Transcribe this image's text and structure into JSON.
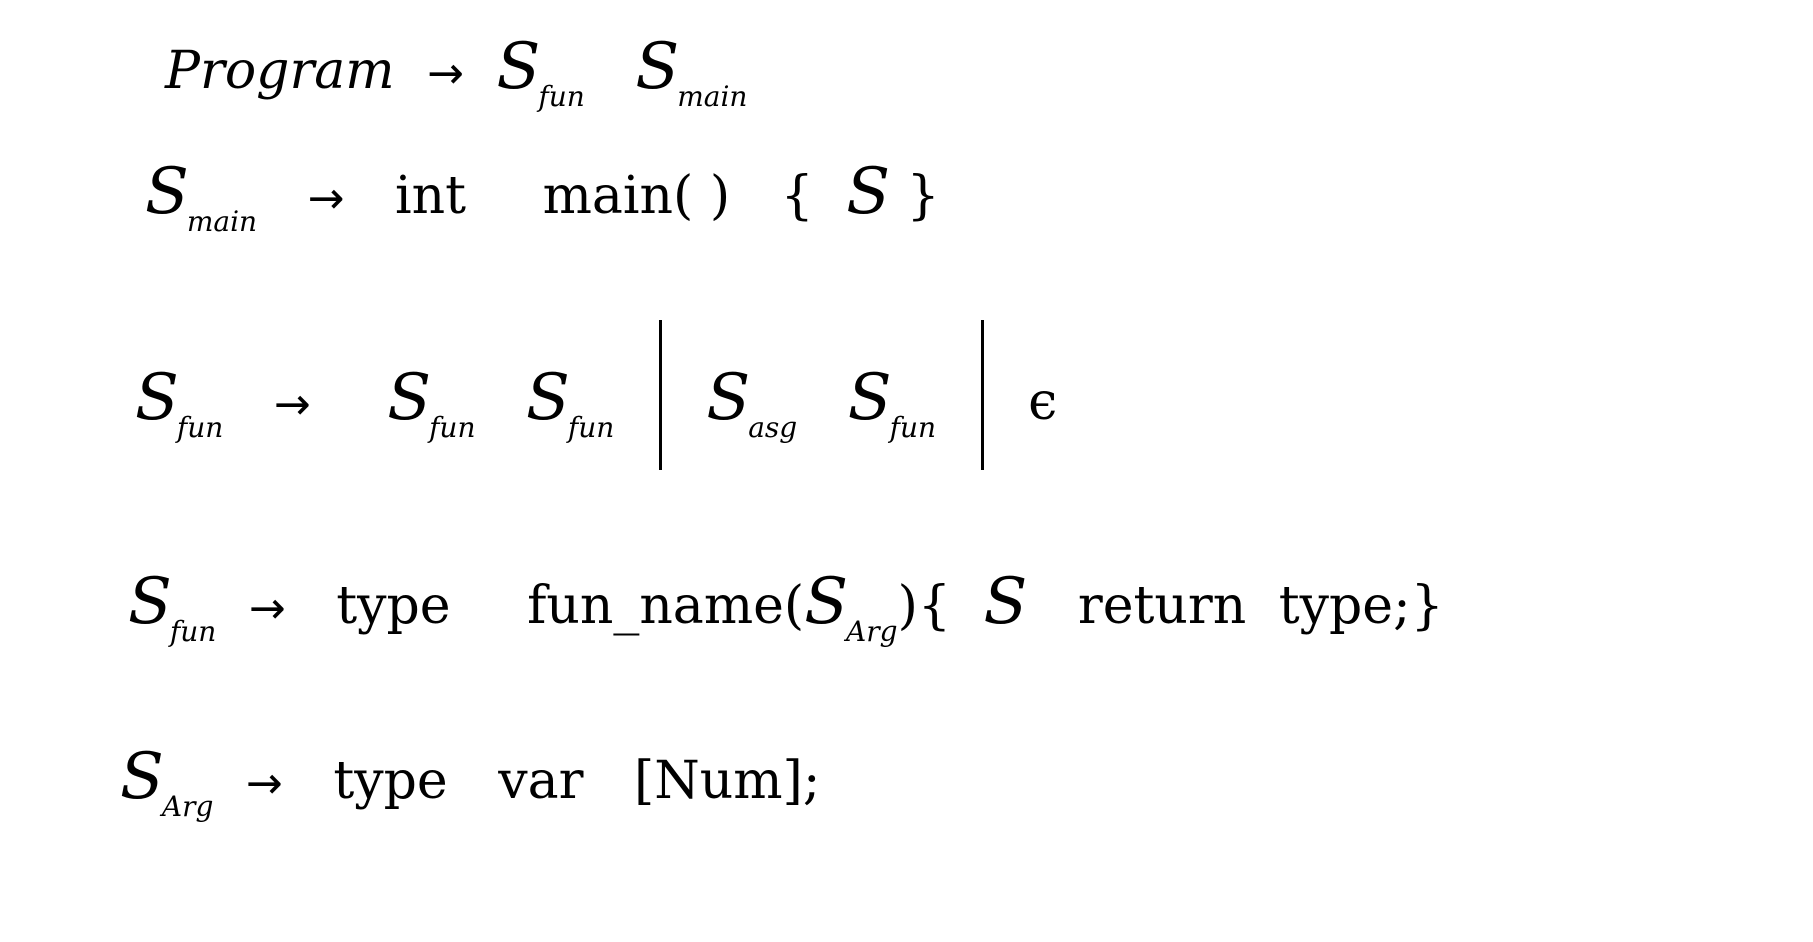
{
  "grammar": {
    "rule1": {
      "lhs": "Program",
      "arrow": "→",
      "rhs": [
        {
          "sym": "S",
          "sub": "fun"
        },
        {
          "sym": "S",
          "sub": "main"
        }
      ]
    },
    "rule2": {
      "lhs": {
        "sym": "S",
        "sub": "main"
      },
      "arrow": "→",
      "rhs": {
        "t1": "int",
        "t2": "main( )",
        "t3": "{",
        "t4": "S",
        "t5": "}"
      }
    },
    "rule3": {
      "lhs": {
        "sym": "S",
        "sub": "fun"
      },
      "arrow": "→",
      "alt1": [
        {
          "sym": "S",
          "sub": "fun"
        },
        {
          "sym": "S",
          "sub": "fun"
        }
      ],
      "alt2": [
        {
          "sym": "S",
          "sub": "asg"
        },
        {
          "sym": "S",
          "sub": "fun"
        }
      ],
      "alt3": "ϵ"
    },
    "rule4": {
      "lhs": {
        "sym": "S",
        "sub": "fun"
      },
      "arrow": "→",
      "rhs": {
        "t1": "type",
        "t2": "fun_name(",
        "arg": {
          "sym": "S",
          "sub": "Arg"
        },
        "t3": "){",
        "t4": "S",
        "t5": "return",
        "t6": "type;}"
      }
    },
    "rule5": {
      "lhs": {
        "sym": "S",
        "sub": "Arg"
      },
      "arrow": "→",
      "rhs": {
        "t1": "type",
        "t2": "var",
        "t3": "[Num];"
      }
    }
  }
}
